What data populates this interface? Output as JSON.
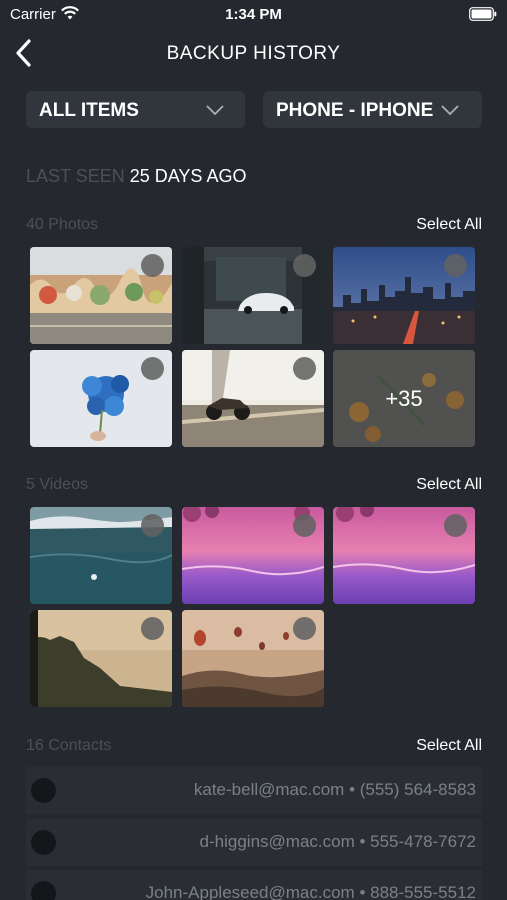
{
  "status_bar": {
    "carrier": "Carrier",
    "time": "1:34 PM"
  },
  "nav": {
    "title": "BACKUP HISTORY"
  },
  "filters": {
    "items_label": "ALL ITEMS",
    "device_label": "PHONE - IPHONE"
  },
  "last_seen": {
    "label": "LAST SEEN",
    "value": "25 DAYS AGO"
  },
  "photos": {
    "title": "40 Photos",
    "select_all": "Select All",
    "more_count": "+35",
    "items": [
      "graffiti-wall",
      "car-in-garage",
      "city-skyline-night",
      "blue-flowers",
      "motorcycle",
      "oranges-on-table"
    ]
  },
  "videos": {
    "title": "5 Videos",
    "select_all": "Select All",
    "items": [
      "ocean-waves",
      "purple-beach-1",
      "purple-beach-2",
      "cliff-coast",
      "hot-air-balloons"
    ]
  },
  "contacts": {
    "title": "16 Contacts",
    "select_all": "Select All",
    "rows": [
      {
        "text": "kate-bell@mac.com • (555) 564-8583"
      },
      {
        "text": "d-higgins@mac.com • 555-478-7672"
      },
      {
        "text": "John-Appleseed@mac.com • 888-555-5512"
      }
    ]
  },
  "colors": {
    "background": "#25292f",
    "dropdown": "#31363d",
    "muted_text": "#4b5058"
  }
}
